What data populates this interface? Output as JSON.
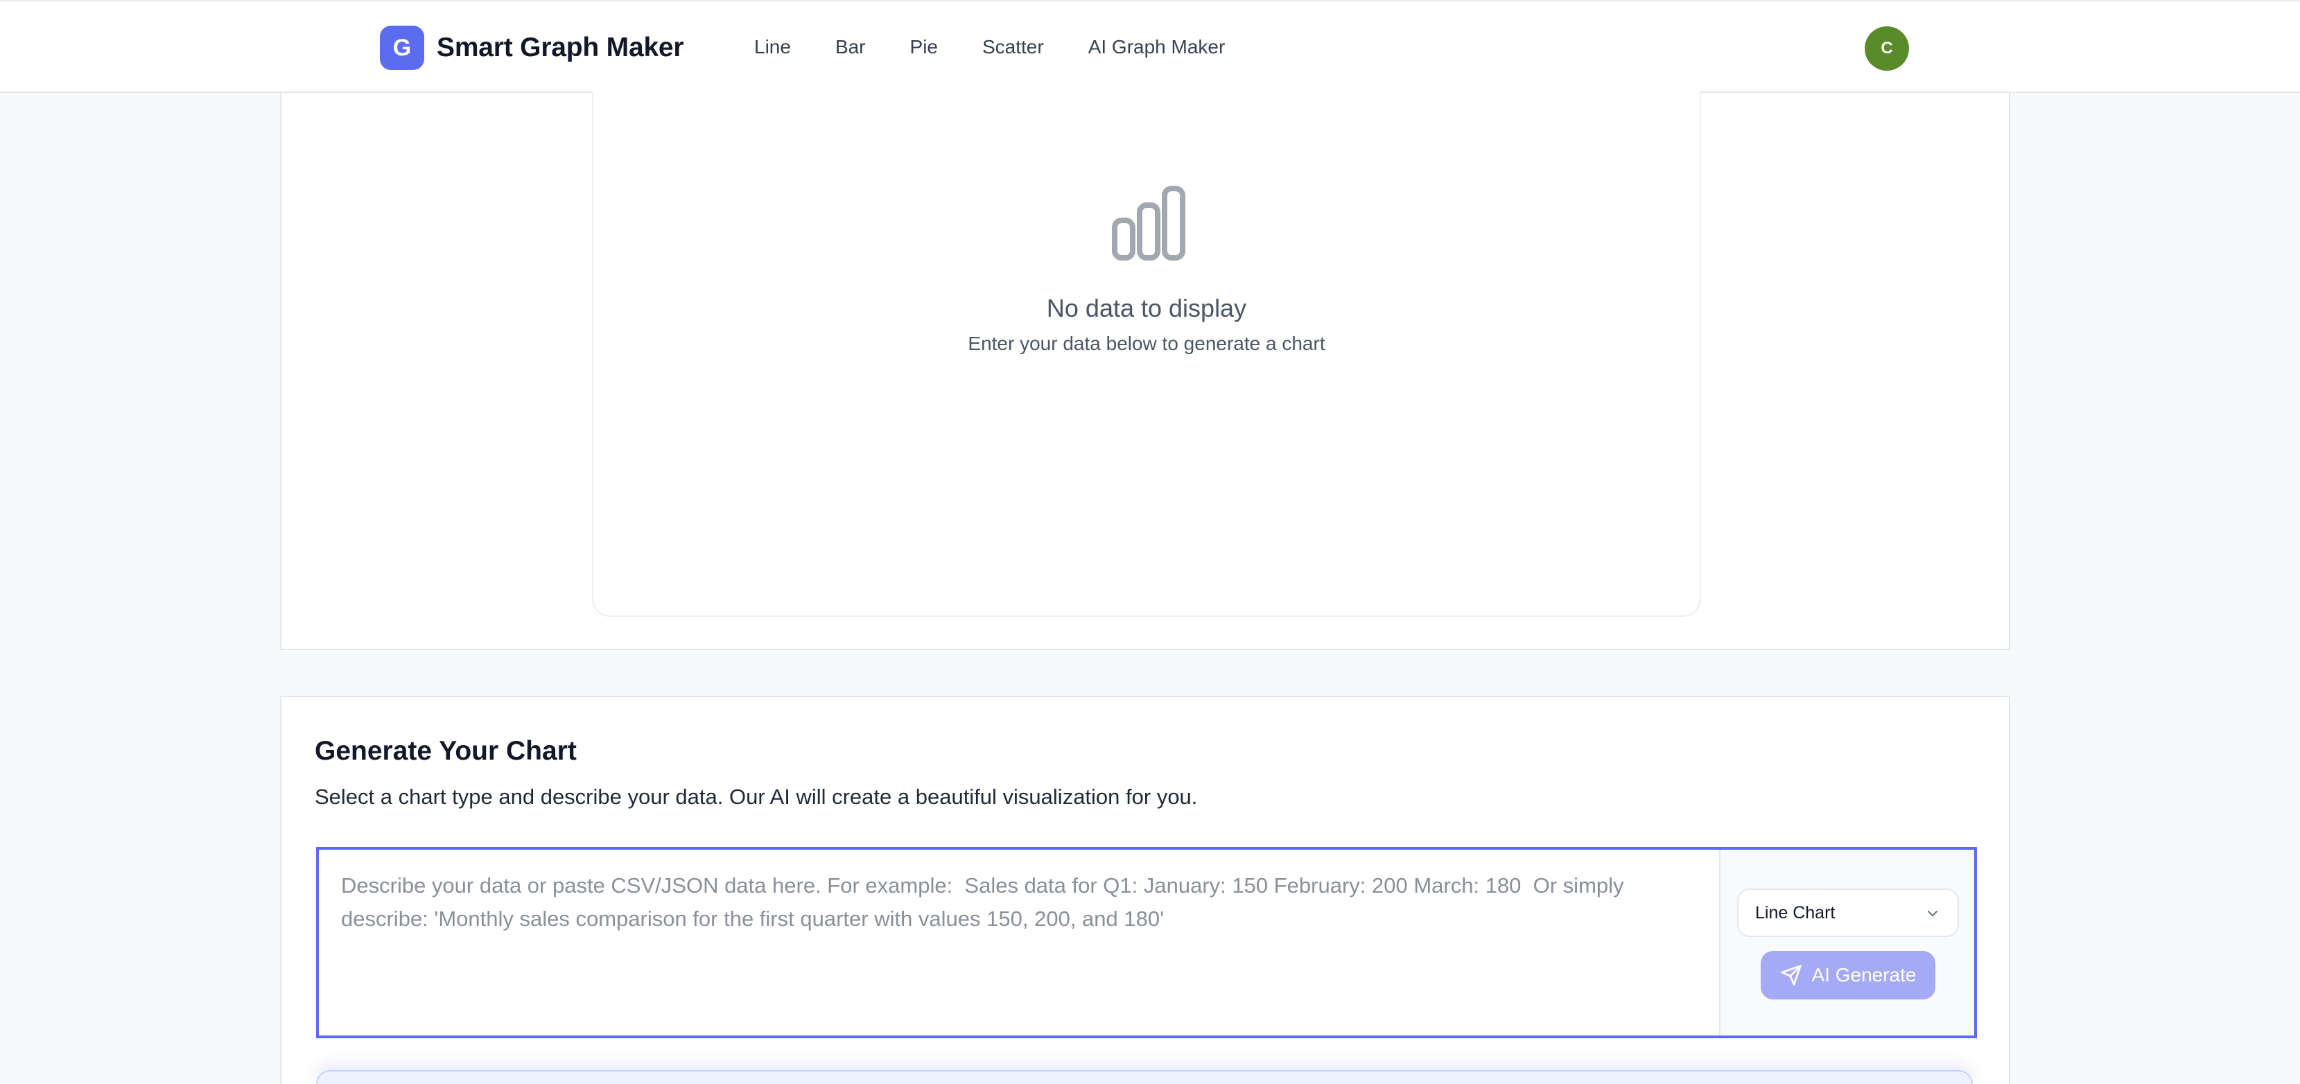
{
  "header": {
    "logo_letter": "G",
    "brand": "Smart Graph Maker",
    "nav": [
      "Line",
      "Bar",
      "Pie",
      "Scatter",
      "AI Graph Maker"
    ],
    "avatar_letter": "C"
  },
  "chart_panel": {
    "empty_icon": "bar-chart-icon",
    "empty_title": "No data to display",
    "empty_subtitle": "Enter your data below to generate a chart"
  },
  "generator": {
    "title": "Generate Your Chart",
    "description": "Select a chart type and describe your data. Our AI will create a beautiful visualization for you.",
    "input_value": "",
    "input_placeholder": "Describe your data or paste CSV/JSON data here. For example:  Sales data for Q1: January: 150 February: 200 March: 180  Or simply describe: 'Monthly sales comparison for the first quarter with values 150, 200, and 180'",
    "chart_type_selected": "Line Chart",
    "generate_label": "AI Generate",
    "send_icon": "send-icon",
    "chevron_icon": "chevron-down-icon"
  },
  "colors": {
    "accent": "#5b6cf0",
    "button_disabled": "#a5aaf7",
    "avatar": "#5a8b2b"
  }
}
